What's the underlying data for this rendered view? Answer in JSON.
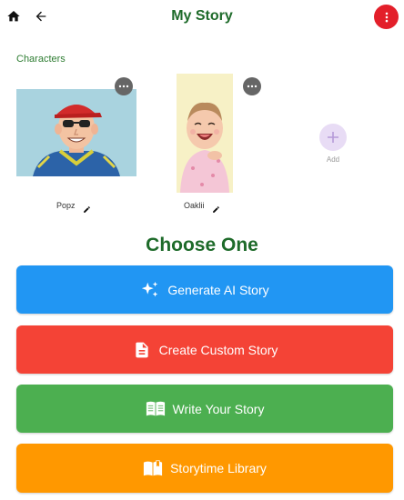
{
  "header": {
    "title": "My Story",
    "icons": {
      "home": "home-icon",
      "back": "arrow-left-icon",
      "menu": "more-vert-icon"
    },
    "menu_color": "#e31f2a"
  },
  "characters": {
    "section_label": "Characters",
    "items": [
      {
        "name": "Popz",
        "image": "cartoon man with red cap and sunglasses"
      },
      {
        "name": "Oaklii",
        "image": "laughing toddler portrait"
      }
    ],
    "add_label": "Add"
  },
  "choose": {
    "title": "Choose One",
    "buttons": [
      {
        "label": "Generate AI Story",
        "icon": "sparkles-icon",
        "color": "#2196f3"
      },
      {
        "label": "Create Custom Story",
        "icon": "document-icon",
        "color": "#f44336"
      },
      {
        "label": "Write Your Story",
        "icon": "open-book-icon",
        "color": "#4caf50"
      },
      {
        "label": "Storytime Library",
        "icon": "library-book-icon",
        "color": "#ff9800"
      }
    ]
  }
}
